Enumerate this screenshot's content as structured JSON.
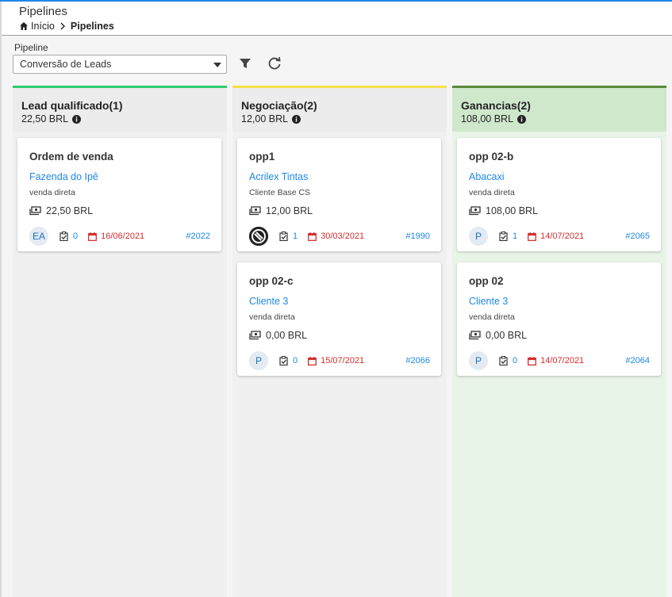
{
  "header": {
    "title": "Pipelines",
    "breadcrumb": {
      "home": "Início",
      "current": "Pipelines"
    }
  },
  "filter": {
    "label": "Pipeline",
    "selected": "Conversão de Leads"
  },
  "columns": [
    {
      "title": "Lead qualificado(1)",
      "total": "22,50 BRL",
      "accent": "#2ecc71",
      "cards": [
        {
          "title": "Ordem de venda",
          "company": "Fazenda do Ipê",
          "type": "venda direta",
          "value": "22,50 BRL",
          "avatar": "EA",
          "tasks": "0",
          "date": "16/06/2021",
          "ref": "#2022"
        }
      ]
    },
    {
      "title": "Negociação(2)",
      "total": "12,00 BRL",
      "accent": "#f4e14a",
      "cards": [
        {
          "title": "opp1",
          "company": "Acrilex Tintas",
          "type": "Cliente Base CS",
          "value": "12,00 BRL",
          "avatar": "",
          "tasks": "1",
          "date": "30/03/2021",
          "ref": "#1990"
        },
        {
          "title": "opp 02-c",
          "company": "Cliente 3",
          "type": "venda direta",
          "value": "0,00 BRL",
          "avatar": "P",
          "tasks": "0",
          "date": "15/07/2021",
          "ref": "#2066"
        }
      ]
    },
    {
      "title": "Ganancias(2)",
      "total": "108,00 BRL",
      "accent": "#5a8a3c",
      "cards": [
        {
          "title": "opp 02-b",
          "company": "Abacaxi",
          "type": "venda direta",
          "value": "108,00 BRL",
          "avatar": "P",
          "tasks": "1",
          "date": "14/07/2021",
          "ref": "#2065"
        },
        {
          "title": "opp 02",
          "company": "Cliente 3",
          "type": "venda direta",
          "value": "0,00 BRL",
          "avatar": "P",
          "tasks": "0",
          "date": "14/07/2021",
          "ref": "#2064"
        }
      ]
    }
  ]
}
